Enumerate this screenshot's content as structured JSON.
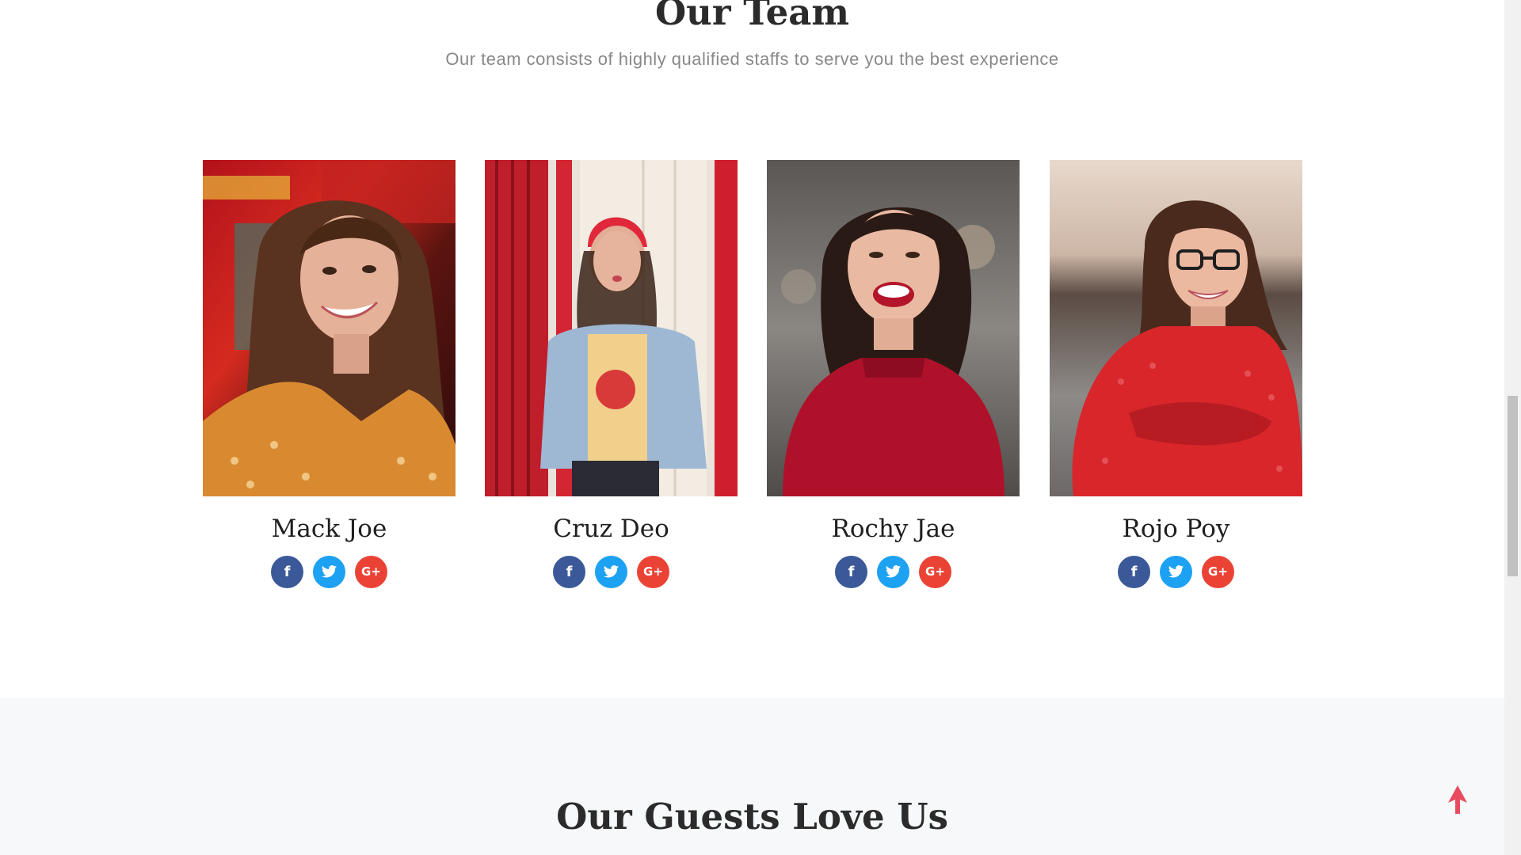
{
  "team": {
    "title": "Our Team",
    "subtitle": "Our team consists of highly qualified staffs to serve you the best experience",
    "members": [
      {
        "name": "Mack Joe",
        "photo": "woman-smiling-orange-top-photo"
      },
      {
        "name": "Cruz Deo",
        "photo": "woman-red-beanie-denim-jacket-photo"
      },
      {
        "name": "Rochy Jae",
        "photo": "woman-laughing-red-top-photo"
      },
      {
        "name": "Rojo Poy",
        "photo": "woman-glasses-red-lace-top-photo"
      }
    ],
    "social_icons": [
      "facebook-icon",
      "twitter-icon",
      "google-plus-icon"
    ],
    "social_glyphs": {
      "facebook": "f",
      "google_plus": "G+"
    }
  },
  "guests": {
    "title": "Our Guests Love Us"
  },
  "colors": {
    "facebook": "#3b5998",
    "twitter": "#1da1f2",
    "google_plus": "#ea4335",
    "accent": "#e84a5f",
    "guests_bg": "#f7f8fa"
  },
  "icons": {
    "back_to_top": "arrow-up-icon"
  }
}
